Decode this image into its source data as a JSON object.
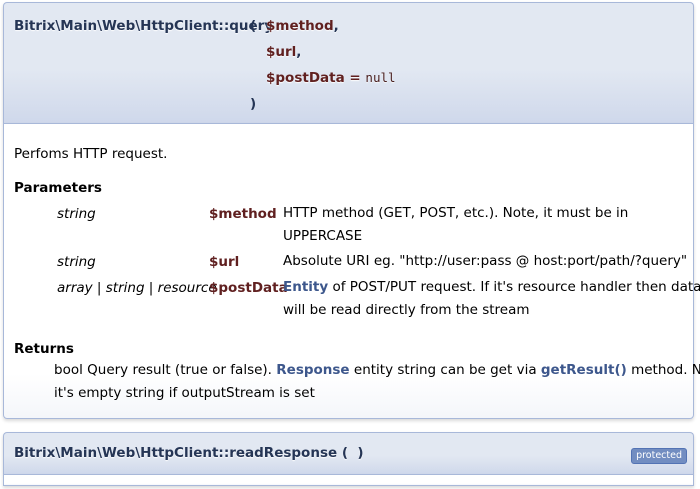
{
  "member1": {
    "signature": {
      "name": "Bitrix\\Main\\Web\\HttpClient::query",
      "open_paren": "(",
      "params": [
        {
          "name": "$method",
          "suffix": ","
        },
        {
          "name": "$url",
          "suffix": ","
        },
        {
          "name": "$postData",
          "suffix": " = ",
          "default": "null"
        }
      ],
      "close_paren": ")"
    },
    "brief": "Perfoms HTTP request.",
    "parameters_title": "Parameters",
    "parameters": [
      {
        "type": "string",
        "name": "$method",
        "desc_line1": "HTTP method (GET, POST, etc.). Note, it must be in",
        "desc_line2": "UPPERCASE"
      },
      {
        "type": "string",
        "name": "$url",
        "desc_line1": "Absolute URI eg. \"http://user:pass @ host:port/path/?query\""
      },
      {
        "type": "array | string | resource",
        "name": "$postData",
        "desc_link": "Entity",
        "desc_line1_rest": " of POST/PUT request. If it's resource handler then data",
        "desc_line2": "will be read directly from the stream"
      }
    ],
    "returns_title": "Returns",
    "returns": {
      "part1": "bool Query result (true or false). ",
      "link1": "Response",
      "part2": " entity string can be get via ",
      "link2": "getResult()",
      "part3": " method. Note,",
      "line2": "it's empty string if outputStream is set"
    }
  },
  "member2": {
    "signature": {
      "name": "Bitrix\\Main\\Web\\HttpClient::readResponse",
      "parens": "(  )"
    },
    "badge": "protected"
  },
  "colors": {
    "header_bg": "#e2e8f2",
    "border": "#a8b8d9",
    "param_name": "#602020",
    "link": "#3d578c",
    "badge_bg": "#728dc1"
  }
}
